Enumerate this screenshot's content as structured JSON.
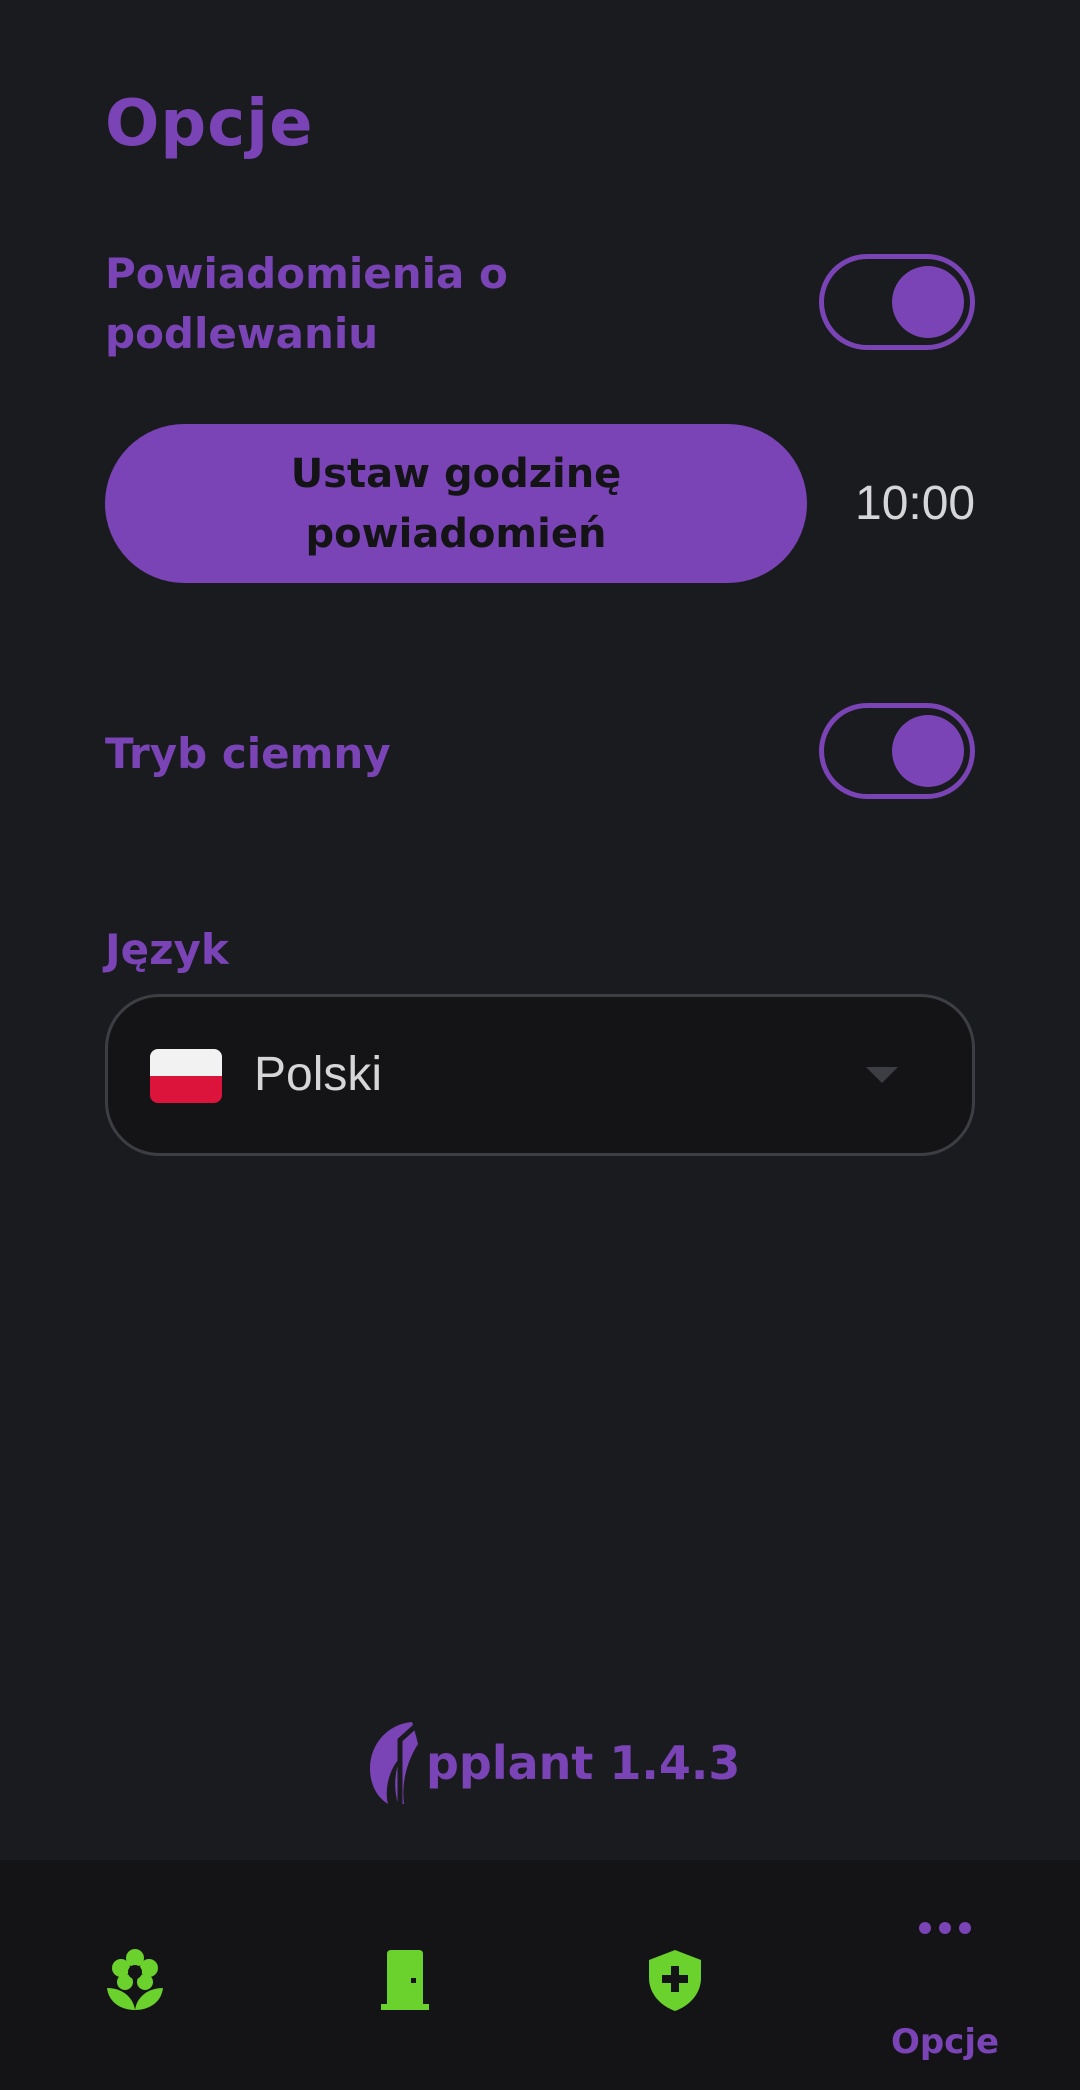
{
  "page": {
    "title": "Opcje"
  },
  "settings": {
    "watering_notifications": {
      "label": "Powiadomienia o podlewaniu",
      "enabled": true
    },
    "set_time_button": {
      "label": "Ustaw godzinę powiadomień"
    },
    "notification_time": "10:00",
    "dark_mode": {
      "label": "Tryb ciemny",
      "enabled": true
    },
    "language": {
      "label": "Język",
      "selected": "Polski",
      "flag": "poland-flag-icon"
    }
  },
  "footer": {
    "app_name_version": "pplant 1.4.3",
    "logo": "applant-logo-leaf-a"
  },
  "bottom_nav": {
    "items": [
      {
        "icon": "flower-icon",
        "label": ""
      },
      {
        "icon": "door-icon",
        "label": ""
      },
      {
        "icon": "shield-plus-icon",
        "label": ""
      },
      {
        "icon": "more-dots-icon",
        "label": "Opcje",
        "active": true
      }
    ]
  },
  "colors": {
    "accent": "#7a44b6",
    "background": "#1a1b1e",
    "nav_background": "#141417",
    "nav_icon_green": "#6bd12d",
    "text_light": "#d6d6d9"
  }
}
